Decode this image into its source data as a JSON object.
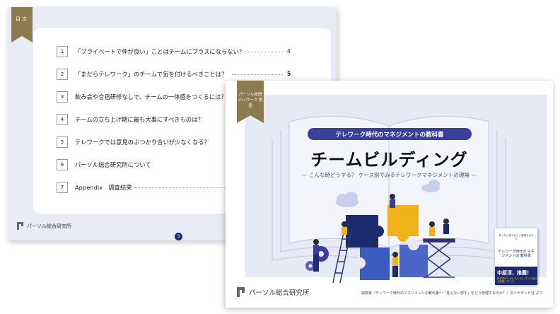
{
  "toc_page": {
    "ribbon_label": "目次",
    "items": [
      {
        "num": "1",
        "title": "「プライベートで仲が良い」ことはチームにプラスにならない？",
        "page": "4"
      },
      {
        "num": "2",
        "title": "「まだらテレワーク」のチームで気を付けるべきことは？",
        "page": "5"
      },
      {
        "num": "3",
        "title": "飲み会や合宿研修なしで、チームの一体感をつくるには？",
        "page": ""
      },
      {
        "num": "4",
        "title": "チームの立ち上げ期に最も大事にすべきものは？",
        "page": ""
      },
      {
        "num": "5",
        "title": "テレワークでは意見のぶつかり合いが少なくなる？",
        "page": ""
      },
      {
        "num": "6",
        "title": "パーソル総合研究所について",
        "page": ""
      },
      {
        "num": "7",
        "title": "Appendix　調査結果",
        "page": ""
      }
    ],
    "logo_text": "パーソル総合研究所",
    "page_number": "3"
  },
  "cover_page": {
    "ribbon_label": "パーソル総研 テレワーク 調査",
    "series_title": "テレワーク時代のマネジメントの教科書",
    "main_title": "チームビルディング",
    "tagline": "— こんな時どうする？ ケース別でみるテレワークマネジメントの現場 —",
    "logo_text": "パーソル総合研究所",
    "credit": "実務書『テレワーク時代のマネジメントの教科書～「見えない部下」をどう管理するのか？』ダイヤモンド社 より",
    "book": {
      "top_text": "見えない部下をどう管理するのか",
      "title": "テレワーク時代の マネジメントの 教科書",
      "author": "中原淳、推薦！",
      "sub": "科学的データにもとづく すぐに使える実践ノウハウ"
    }
  },
  "colors": {
    "navy": "#1c2a6e",
    "indigo": "#3b3f9c",
    "gold": "#8c7a50",
    "yellow": "#f0b21a",
    "light_bg": "#e6e9f6"
  }
}
